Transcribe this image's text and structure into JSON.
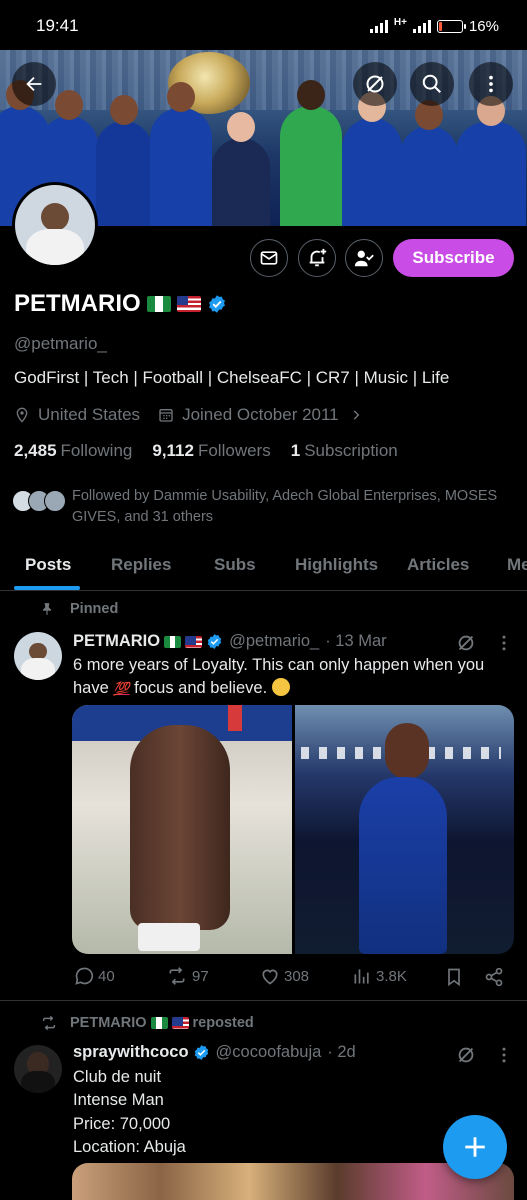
{
  "status_bar": {
    "time": "19:41",
    "network": "H+",
    "battery": "16%",
    "battery_level": 0.16
  },
  "profile": {
    "name": "PETMARIO",
    "handle": "@petmario_",
    "bio": "GodFirst | Tech | Football | ChelseaFC | CR7 | Music | Life",
    "location": "United States",
    "joined": "Joined October 2011",
    "following_count": "2,485",
    "following_label": "Following",
    "followers_count": "9,112",
    "followers_label": "Followers",
    "subscription_count": "1",
    "subscription_label": "Subscription",
    "followed_by": "Followed by Dammie Usability, Adech Global Enterprises, MOSES GIVES, and 31 others",
    "subscribe_label": "Subscribe"
  },
  "tabs": [
    {
      "label": "Posts",
      "active": true
    },
    {
      "label": "Replies"
    },
    {
      "label": "Subs"
    },
    {
      "label": "Highlights"
    },
    {
      "label": "Articles"
    },
    {
      "label": "Me"
    }
  ],
  "posts": [
    {
      "context": "Pinned",
      "author": "PETMARIO",
      "handle": "@petmario_",
      "date": "· 13 Mar",
      "text_before": "6 more years of Loyalty. This can only happen when you have ",
      "emoji_100": "💯",
      "text_after": " focus and believe. ",
      "stats": {
        "replies": "40",
        "reposts": "97",
        "likes": "308",
        "views": "3.8K"
      }
    },
    {
      "context": "PETMARIO 🇳🇬🇺🇸 reposted",
      "context_name": "PETMARIO",
      "context_suffix": "reposted",
      "author": "spraywithcoco",
      "handle": "@cocoofabuja",
      "date": "· 2d",
      "lines": [
        "Club de nuit",
        "Intense Man",
        "Price: 70,000",
        "Location: Abuja"
      ]
    }
  ],
  "colors": {
    "accent": "#1d9bf0",
    "subscribe": "#c94ce6",
    "muted": "#71767b",
    "background": "#000000"
  }
}
